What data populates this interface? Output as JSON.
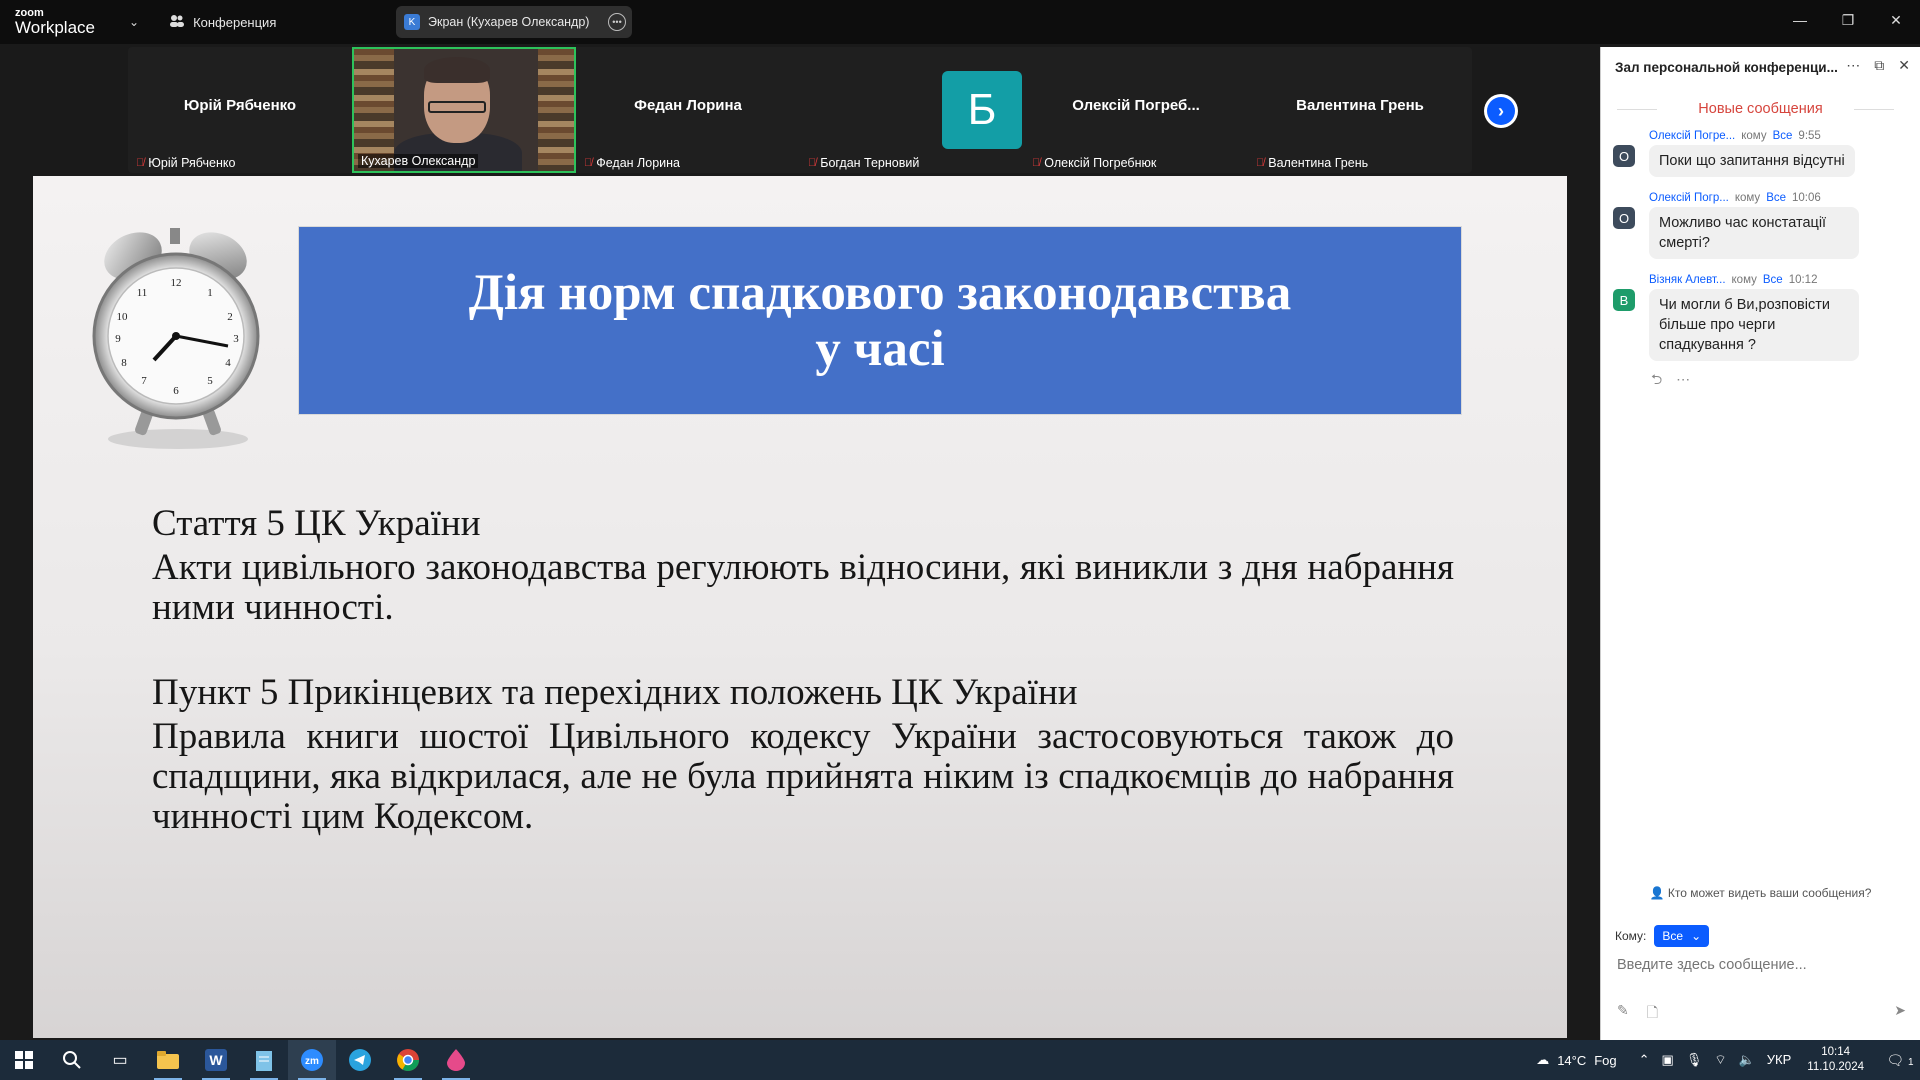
{
  "titlebar": {
    "logo_small": "zoom",
    "logo_big": "Workplace",
    "conference_label": "Конференция",
    "screen_tab_initial": "K",
    "screen_tab_label": "Экран (Кухарев Олександр)"
  },
  "gallery": {
    "tiles": [
      {
        "big_name": "Юрій Рябченко",
        "label": "Юрій Рябченко"
      },
      {
        "label": "Кухарев Олександр"
      },
      {
        "big_name": "Федан Лорина",
        "label": "Федан Лорина"
      },
      {
        "avatar_letter": "Б",
        "label": "Богдан Терновий"
      },
      {
        "big_name": "Олексій  Погреб...",
        "label": "Олексій Погребнюк"
      },
      {
        "big_name": "Валентина Грень",
        "label": "Валентина Грень"
      }
    ]
  },
  "slide": {
    "title_line1": "Дія норм спадкового законодавства",
    "title_line2": "у часі",
    "heading1": "Стаття 5 ЦК України",
    "body1": "Акти цивільного законодавства регулюють відносини, які виникли з дня набрання ними чинності.",
    "heading2": "Пункт 5 Прикінцевих та перехідних положень ЦК України",
    "body2": "Правила книги шостої Цивільного кодексу України застосовуються також до спадщини, яка відкрилася, але не була прийнята ніким із спадкоємців до набрання чинності цим Кодексом."
  },
  "chat": {
    "title": "Зал персональной конференци...",
    "new_messages": "Новые сообщения",
    "messages": [
      {
        "avatar": "O",
        "avatar_color": "#3d4b5c",
        "from": "Олексій Погре...",
        "to_prefix": "кому",
        "to": "Все",
        "time": "9:55",
        "text": "Поки що запитання відсутні"
      },
      {
        "avatar": "O",
        "avatar_color": "#3d4b5c",
        "from": "Олексій Погр...",
        "to_prefix": "кому",
        "to": "Все",
        "time": "10:06",
        "text": "Можливо час констатації смерті?"
      },
      {
        "avatar": "В",
        "avatar_color": "#1e9c6a",
        "from": "Візняк  Алевт...",
        "to_prefix": "кому",
        "to": "Все",
        "time": "10:12",
        "text": "Чи могли б Ви,розповісти більше про черги спадкування ?"
      }
    ],
    "who_can_see": "Кто может видеть ваши сообщения?",
    "to_label": "Кому:",
    "to_value": "Все",
    "input_placeholder": "Введите здесь сообщение..."
  },
  "taskbar": {
    "temperature": "14°C",
    "weather": "Fog",
    "language": "УКР",
    "time": "10:14",
    "date": "11.10.2024",
    "notifications": "1"
  },
  "colors": {
    "title_box": "#4470c8",
    "accent": "#0b5cff",
    "new_messages": "#d6453d",
    "active_speaker": "#2dc25b"
  }
}
